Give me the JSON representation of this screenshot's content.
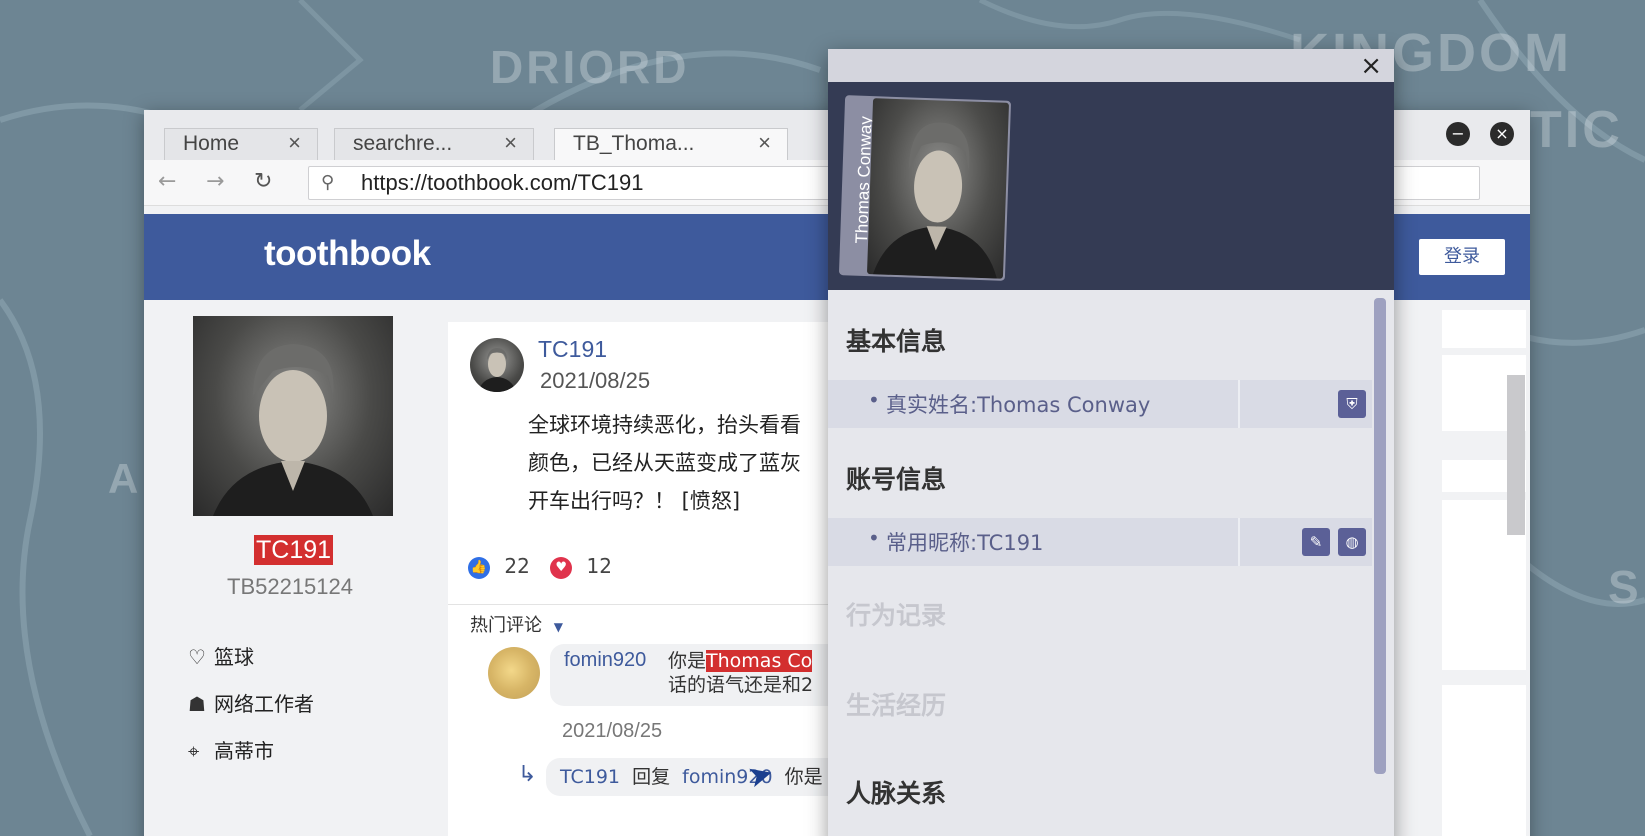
{
  "background": {
    "map_labels": [
      "DRIORD",
      "KINGDOM",
      "A",
      "S",
      "TIC"
    ]
  },
  "browser": {
    "tabs": [
      {
        "label": "Home",
        "close": "×"
      },
      {
        "label": "searchre...",
        "close": "×"
      },
      {
        "label": "TB_Thoma...",
        "close": "×"
      }
    ],
    "window_controls": {
      "minimize": "−",
      "close": "×"
    },
    "nav": {
      "back": "←",
      "forward": "→",
      "reload": "↻"
    },
    "url": "https://toothbook.com/TC191"
  },
  "site": {
    "logo": "toothbook",
    "login_label": "登录",
    "brand_color": "#3e5a9c"
  },
  "profile": {
    "name": "TC191",
    "id": "TB52215124",
    "info": [
      {
        "icon": "heart-icon",
        "glyph": "♡",
        "label": "篮球"
      },
      {
        "icon": "tie-icon",
        "glyph": "☗",
        "label": "网络工作者"
      },
      {
        "icon": "location-icon",
        "glyph": "⌖",
        "label": "高蒂市"
      }
    ]
  },
  "post": {
    "user": "TC191",
    "date": "2021/08/25",
    "text_lines": [
      "全球环境持续恶化，抬头看看",
      "颜色，已经从天蓝变成了蓝灰",
      "开车出行吗？！ [愤怒]"
    ],
    "likes": "22",
    "hearts": "12",
    "hot_comments_label": "热门评论",
    "comment": {
      "user": "fomin920",
      "text_before": "你是",
      "text_highlight": "Thomas Co",
      "text_line2": "话的语气还是和2",
      "date": "2021/08/25"
    },
    "reply": {
      "user": "TC191",
      "verb": "回复",
      "target": "fomin920",
      "text": "你是"
    }
  },
  "popup": {
    "close": "×",
    "card_name": "Thomas Conway",
    "sections": {
      "basic": "基本信息",
      "account": "账号信息",
      "behavior": "行为记录",
      "life": "生活经历",
      "relations": "人脉关系"
    },
    "fields": {
      "real_name": "真实姓名:Thomas Conway",
      "nickname": "常用昵称:TC191"
    },
    "accent_color": "#5b6097"
  }
}
